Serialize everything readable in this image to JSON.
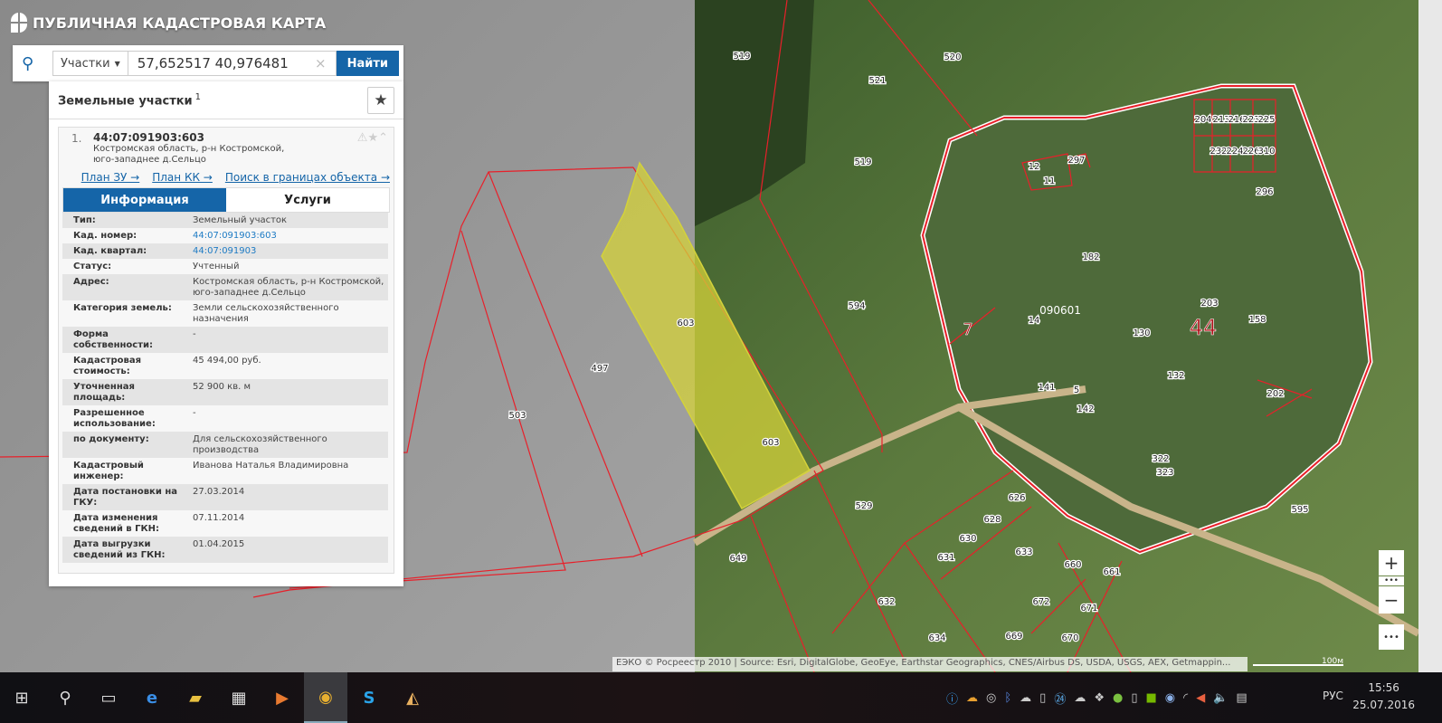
{
  "app": {
    "title": "ПУБЛИЧНАЯ КАДАСТРОВАЯ КАРТА"
  },
  "search": {
    "type": "Участки",
    "query": "57,652517 40,976481",
    "clear": "×",
    "button": "Найти"
  },
  "results": {
    "title": "Земельные участки",
    "count": "1",
    "item": {
      "index": "1.",
      "cad_number": "44:07:091903:603",
      "address": "Костромская область, р-н Костромской, юго-западнее д.Сельцо",
      "links": [
        "План ЗУ →",
        "План КК →",
        "Поиск в границах объекта →"
      ],
      "tabs": [
        "Информация",
        "Услуги"
      ],
      "rows": [
        {
          "label": "Тип:",
          "value": "Земельный участок"
        },
        {
          "label": "Кад. номер:",
          "value": "44:07:091903:603"
        },
        {
          "label": "Кад. квартал:",
          "value": "44:07:091903"
        },
        {
          "label": "Статус:",
          "value": "Учтенный"
        },
        {
          "label": "Адрес:",
          "value": "Костромская область, р-н Костромской, юго-западнее д.Сельцо"
        },
        {
          "label": "Категория земель:",
          "value": "Земли сельскохозяйственного назначения"
        },
        {
          "label": "Форма собственности:",
          "value": "-"
        },
        {
          "label": "Кадастровая стоимость:",
          "value": "45 494,00 руб."
        },
        {
          "label": "Уточненная площадь:",
          "value": "52 900 кв. м"
        },
        {
          "label": "Разрешенное использование:",
          "value": "-"
        },
        {
          "label": "по документу:",
          "value": "Для сельскохозяйственного производства"
        },
        {
          "label": "Кадастровый инженер:",
          "value": "Иванова Наталья Владимировна"
        },
        {
          "label": "Дата постановки на ГКУ:",
          "value": "27.03.2014"
        },
        {
          "label": "Дата изменения сведений в ГКН:",
          "value": "07.11.2014"
        },
        {
          "label": "Дата выгрузки сведений из ГКН:",
          "value": "01.04.2015"
        }
      ]
    }
  },
  "map": {
    "labels": [
      "519",
      "520",
      "521",
      "519",
      "603",
      "497",
      "503",
      "603",
      "594",
      "7",
      "090601",
      "44",
      "12",
      "11",
      "297",
      "182",
      "14",
      "130",
      "203",
      "158",
      "132",
      "141",
      "5",
      "142",
      "202",
      "322",
      "323",
      "296",
      "204",
      "213",
      "216",
      "223",
      "225",
      "232",
      "224",
      "226",
      "310",
      "529",
      "626",
      "628",
      "630",
      "631",
      "633",
      "660",
      "661",
      "632",
      "672",
      "671",
      "634",
      "669",
      "670",
      "649",
      "595"
    ],
    "attribution": "ЕЭКО © Росреестр 2010 | Source: Esri, DigitalGlobe, GeoEye, Earthstar Geographics, CNES/Airbus DS, USDA, USGS, AEX, Getmappin...",
    "scale": "100м",
    "zoom_in": "+",
    "zoom_out": "−",
    "more": "•••",
    "selected_color": "#d4d23a",
    "boundary_color": "#e8202a"
  },
  "taskbar": {
    "lang": "РУС",
    "time": "15:56",
    "date": "25.07.2016"
  }
}
